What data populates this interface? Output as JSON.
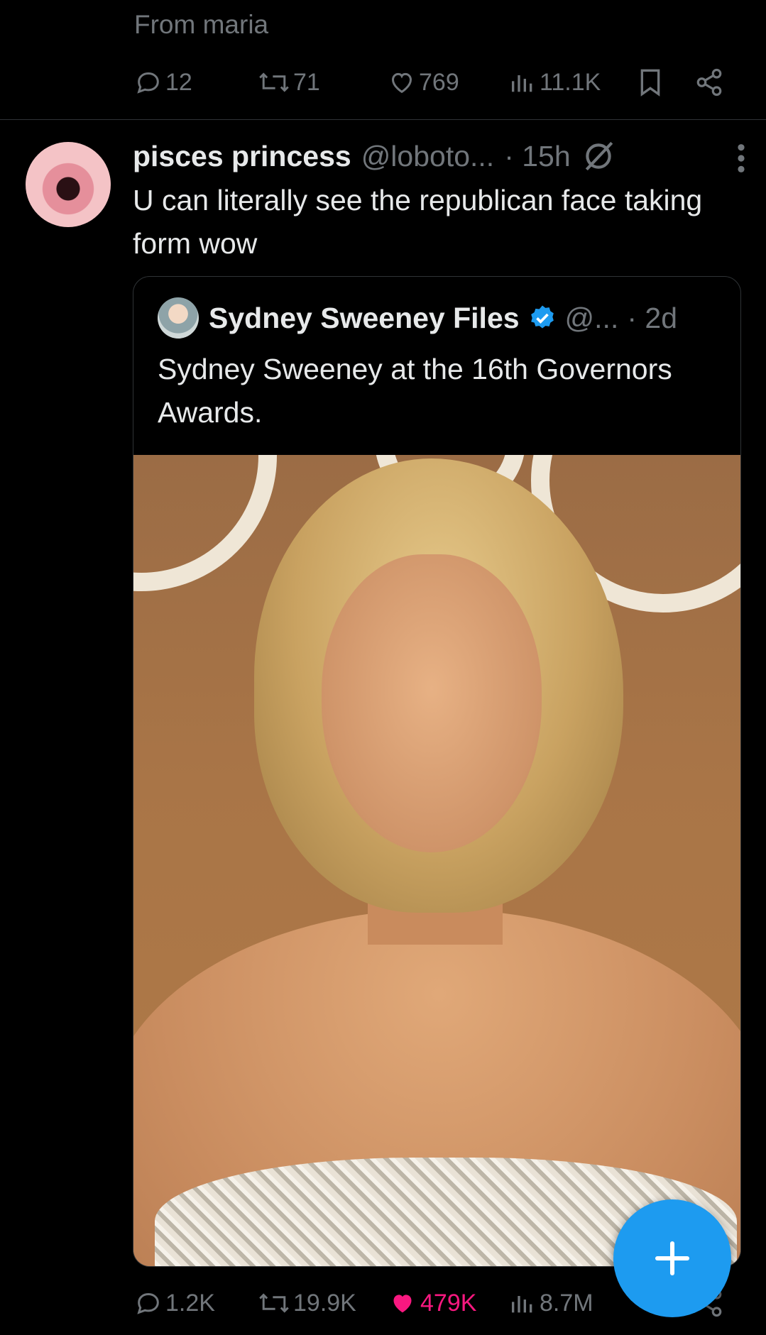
{
  "previous_tweet": {
    "from_line": "From maria",
    "actions": {
      "replies": "12",
      "reposts": "71",
      "likes": "769",
      "views": "11.1K"
    }
  },
  "reply_tweet": {
    "display_name": "pisces princess",
    "handle": "@loboto...",
    "time": "· 15h",
    "text": "U can literally see the republican face taking form wow",
    "quoted_tweet": {
      "display_name": "Sydney Sweeney Files",
      "handle": "@...",
      "time": "· 2d",
      "text": "Sydney Sweeney at the 16th Governors Awards."
    },
    "actions": {
      "replies": "1.2K",
      "reposts": "19.9K",
      "likes": "479K",
      "views": "8.7M"
    }
  },
  "colors": {
    "background": "#000000",
    "text": "#e7e9ea",
    "muted": "#71767b",
    "accent_blue": "#1d9bf0",
    "like_pink": "#f91880"
  }
}
